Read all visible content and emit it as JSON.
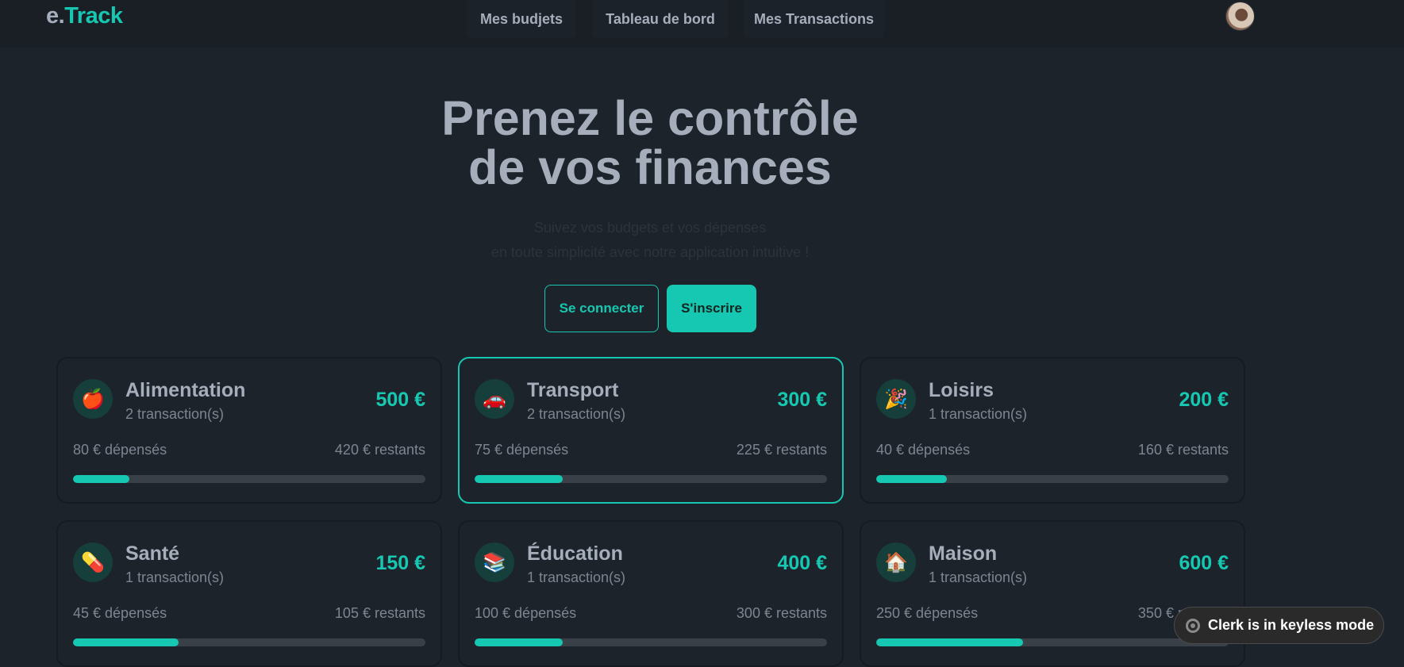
{
  "logo": {
    "prefix": "e.",
    "main": "Track"
  },
  "nav": {
    "items": [
      "Mes budjets",
      "Tableau de bord",
      "Mes Transactions"
    ]
  },
  "hero": {
    "title_line1": "Prenez le contrôle",
    "title_line2": "de vos finances",
    "subtitle_line1": "Suivez vos budgets et vos dépenses",
    "subtitle_line2": "en toute simplicité avec notre application intuitive !"
  },
  "buttons": {
    "login": "Se connecter",
    "signup": "S'inscrire"
  },
  "cards": [
    {
      "icon": "🍎",
      "icon_name": "apple-icon",
      "name": "Alimentation",
      "count": "2 transaction(s)",
      "amount": "500 €",
      "spent": "80 € dépensés",
      "remaining": "420 € restants",
      "progress": 0.16
    },
    {
      "icon": "🚗",
      "icon_name": "car-icon",
      "name": "Transport",
      "count": "2 transaction(s)",
      "amount": "300 €",
      "spent": "75 € dépensés",
      "remaining": "225 € restants",
      "progress": 0.25
    },
    {
      "icon": "🎉",
      "icon_name": "party-icon",
      "name": "Loisirs",
      "count": "1 transaction(s)",
      "amount": "200 €",
      "spent": "40 € dépensés",
      "remaining": "160 € restants",
      "progress": 0.2
    },
    {
      "icon": "💊",
      "icon_name": "pill-icon",
      "name": "Santé",
      "count": "1 transaction(s)",
      "amount": "150 €",
      "spent": "45 € dépensés",
      "remaining": "105 € restants",
      "progress": 0.3
    },
    {
      "icon": "📚",
      "icon_name": "books-icon",
      "name": "Éducation",
      "count": "1 transaction(s)",
      "amount": "400 €",
      "spent": "100 € dépensés",
      "remaining": "300 € restants",
      "progress": 0.25
    },
    {
      "icon": "🏠",
      "icon_name": "house-icon",
      "name": "Maison",
      "count": "1 transaction(s)",
      "amount": "600 €",
      "spent": "250 € dépensés",
      "remaining": "350 € restants",
      "progress": 0.4167
    }
  ],
  "clerk": {
    "label": "Clerk is in keyless mode"
  },
  "colors": {
    "accent": "#16c8b1",
    "background": "#1d232a"
  }
}
